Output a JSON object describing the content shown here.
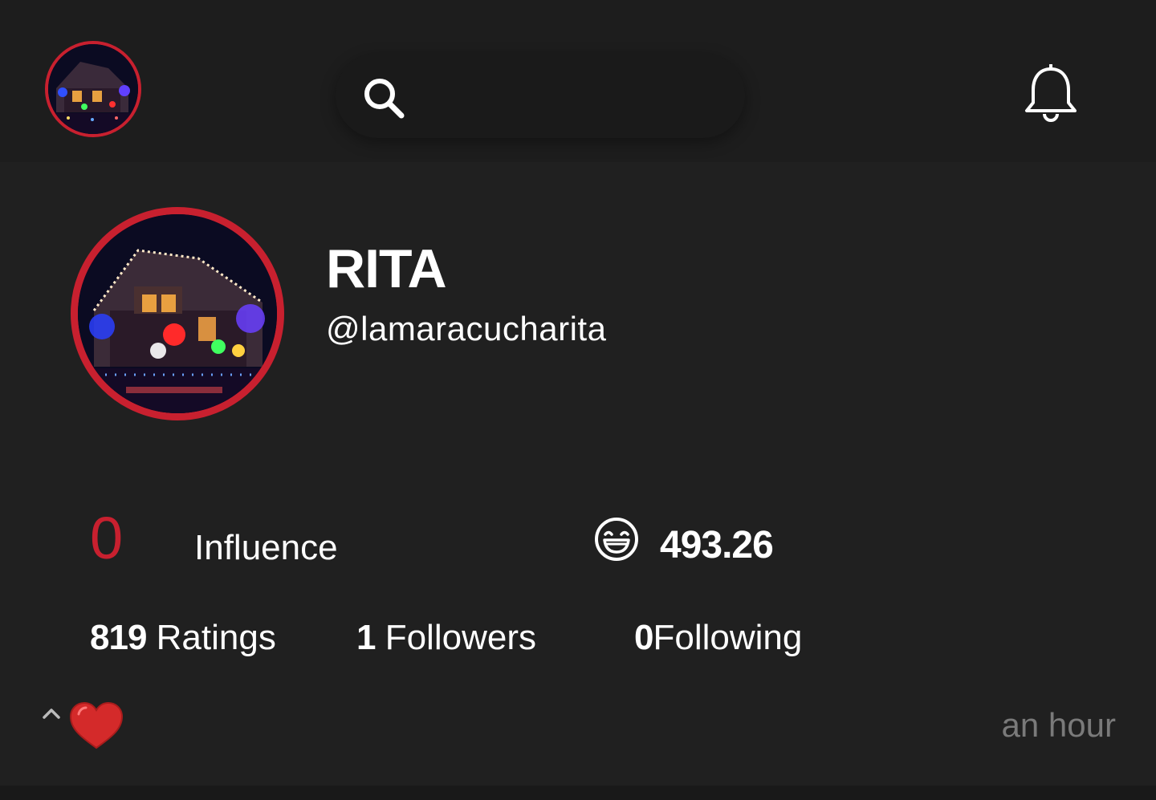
{
  "header": {
    "avatar_alt": "christmas-lights-house-photo",
    "search": {
      "placeholder": ""
    },
    "icons": {
      "search": "search-icon",
      "notifications": "bell-icon"
    }
  },
  "profile": {
    "name": "RITA",
    "handle": "@lamaracucharita"
  },
  "stats": {
    "influence_value": "0",
    "influence_label": "Influence",
    "score_icon": "laughing-face-icon",
    "score_value": "493.26",
    "ratings_count": "819",
    "ratings_label": " Ratings",
    "followers_count": "1",
    "followers_label": " Followers",
    "following_count": "0",
    "following_label": "Following"
  },
  "footer": {
    "collapse_icon": "chevron-up-icon",
    "reaction_icon": "heart-icon",
    "timestamp": "an hour"
  },
  "colors": {
    "accent": "#c8202f",
    "background": "#202020",
    "header_background": "#1d1d1d",
    "muted_text": "#7a7a7a"
  }
}
